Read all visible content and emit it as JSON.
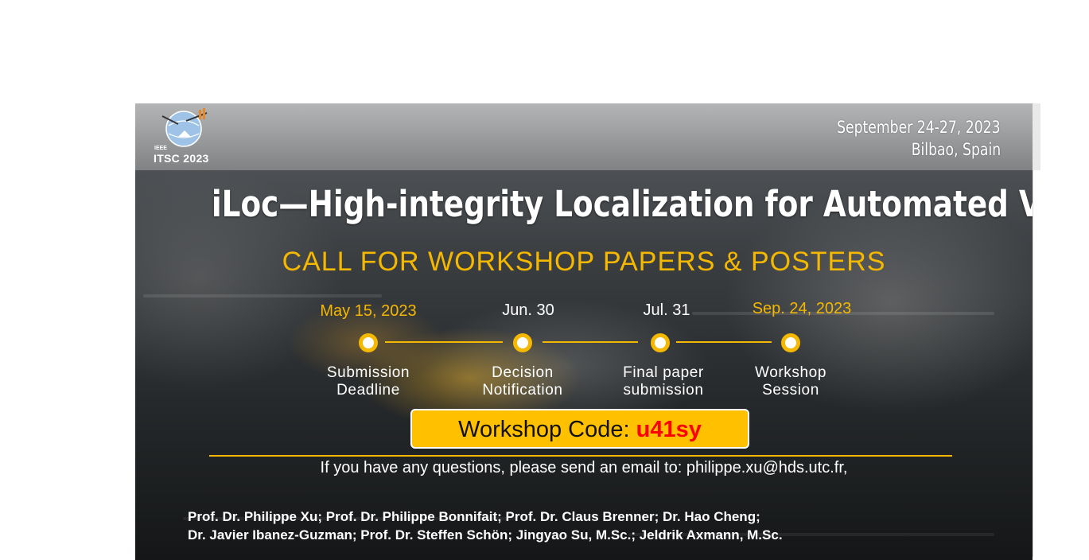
{
  "header": {
    "logo_org": "IEEE",
    "logo_name": "ITSC 2023",
    "date": "September 24-27, 2023",
    "location": "Bilbao, Spain"
  },
  "title": "iLoc—High-integrity Localization for Automated Vehicles",
  "subtitle": "CALL FOR WORKSHOP PAPERS & POSTERS",
  "timeline": [
    {
      "date": "May 15, 2023",
      "label_1": "Submission",
      "label_2": "Deadline"
    },
    {
      "date": "Jun. 30",
      "label_1": "Decision",
      "label_2": "Notification"
    },
    {
      "date": "Jul. 31",
      "label_1": "Final paper",
      "label_2": "submission"
    },
    {
      "date": "Sep. 24, 2023",
      "label_1": "Workshop",
      "label_2": "Session"
    }
  ],
  "workshop_code": {
    "label": "Workshop Code: ",
    "value": "u41sy"
  },
  "contact": "If you have any questions, please send an email to: philippe.xu@hds.utc.fr,",
  "authors": {
    "line_1": "Prof. Dr. Philippe Xu; Prof. Dr. Philippe Bonnifait; Prof. Dr. Claus Brenner; Dr. Hao Cheng;",
    "line_2": "Dr. Javier Ibanez-Guzman; Prof. Dr. Steffen Schön; Jingyao Su, M.Sc.; Jeldrik Axmann, M.Sc."
  },
  "colors": {
    "accent": "#f5b800",
    "code_box": "#ffc000",
    "code_value": "#ff0000",
    "text": "#ffffff"
  }
}
